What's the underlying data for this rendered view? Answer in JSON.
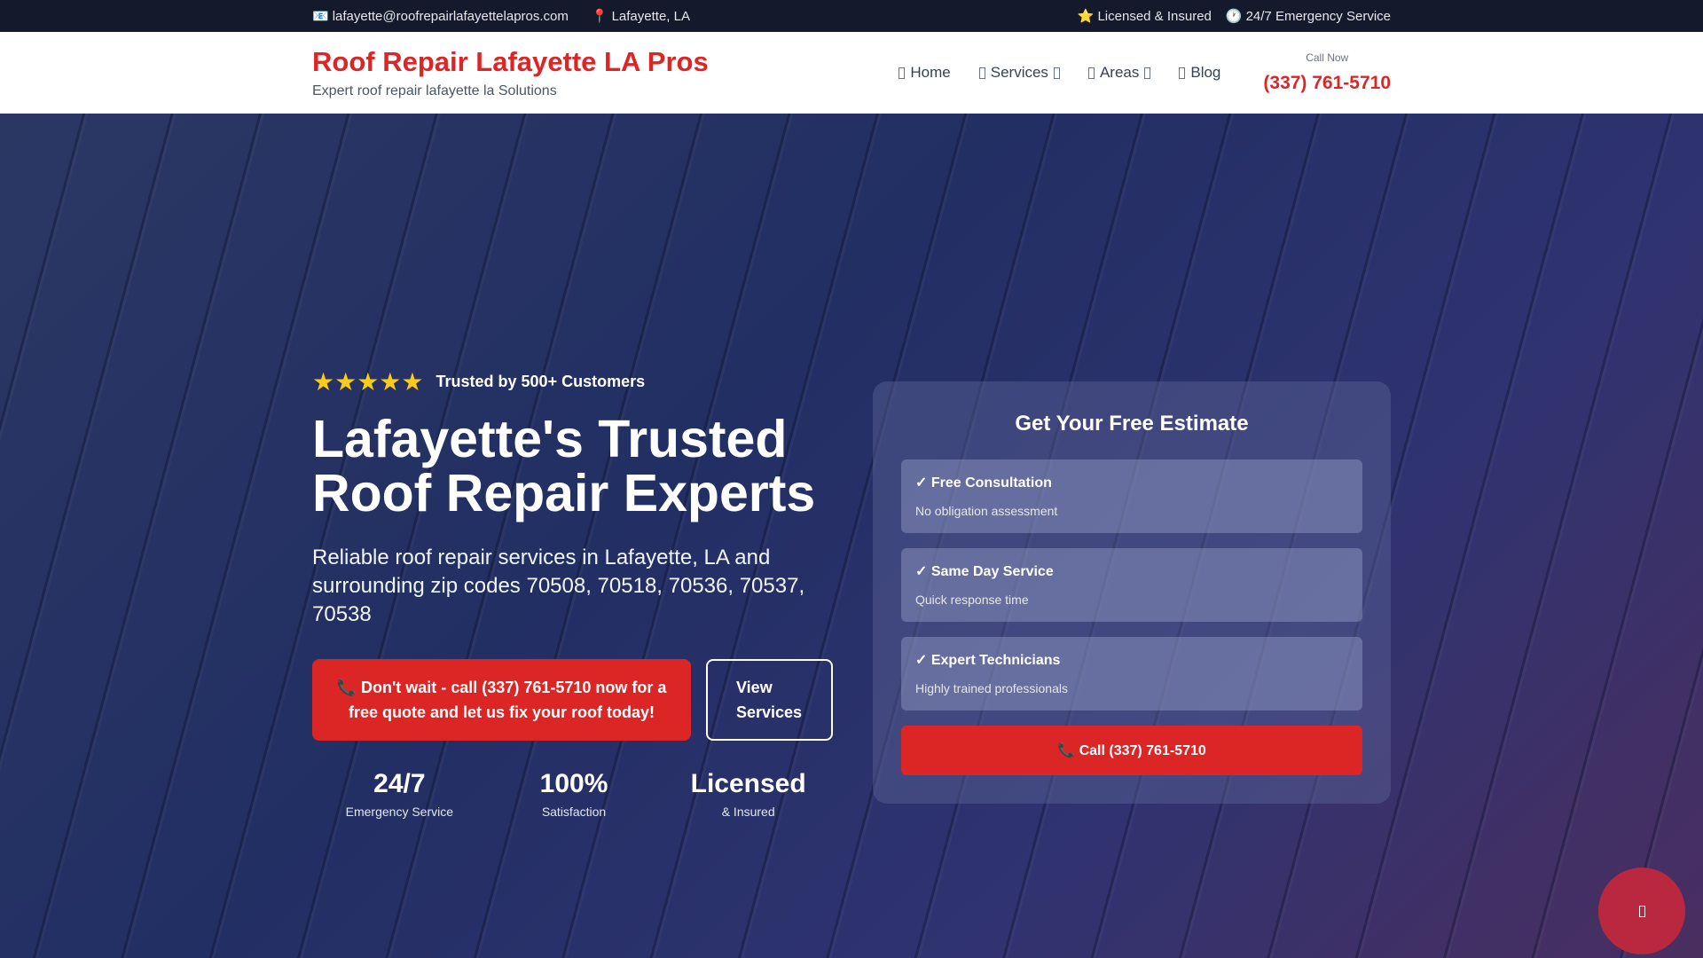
{
  "topbar": {
    "email": "lafayette@roofrepairlafayettelapros.com",
    "email_icon": "📧",
    "location": "Lafayette, LA",
    "location_icon": "📍",
    "licensed": "Licensed & Insured",
    "licensed_icon": "⭐",
    "emergency": "24/7 Emergency Service",
    "emergency_icon": "🕐"
  },
  "header": {
    "title": "Roof Repair Lafayette LA Pros",
    "subtitle": "Expert roof repair lafayette la Solutions",
    "nav": [
      "Home",
      "Services",
      "Areas",
      "Blog"
    ],
    "call_label": "Call Now",
    "phone": "(337) 761-5710"
  },
  "hero": {
    "stars": "★★★★★",
    "trusted": "Trusted by 500+ Customers",
    "headline": "Lafayette's Trusted Roof Repair Experts",
    "description": "Reliable roof repair services in Lafayette, LA and surrounding zip codes 70508, 70518, 70536, 70537, 70538",
    "cta_primary": "📞 Don't wait - call (337) 761-5710 now for a free quote and let us fix your roof today!",
    "cta_secondary": "View Services",
    "stats": [
      {
        "value": "24/7",
        "label": "Emergency Service"
      },
      {
        "value": "100%",
        "label": "Satisfaction"
      },
      {
        "value": "Licensed",
        "label": "& Insured"
      }
    ]
  },
  "estimate": {
    "title": "Get Your Free Estimate",
    "features": [
      {
        "title": "✓ Free Consultation",
        "sub": "No obligation assessment"
      },
      {
        "title": "✓ Same Day Service",
        "sub": "Quick response time"
      },
      {
        "title": "✓ Expert Technicians",
        "sub": "Highly trained professionals"
      }
    ],
    "cta": "📞 Call (337) 761-5710"
  },
  "colors": {
    "accent": "#dc2626",
    "topbar": "#141a2b"
  }
}
